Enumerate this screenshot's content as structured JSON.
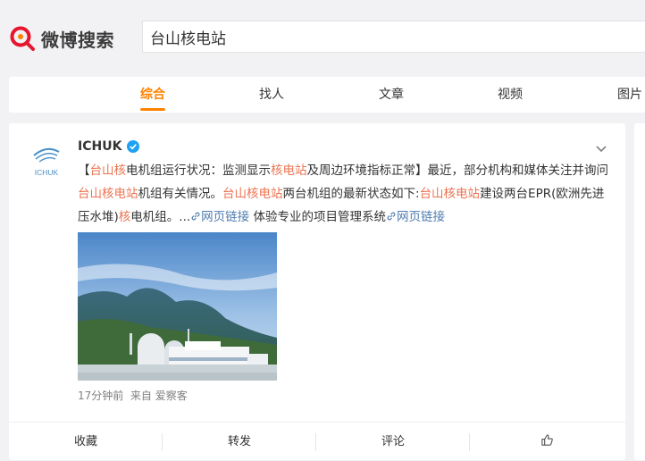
{
  "logo": {
    "text": "微博搜索"
  },
  "search": {
    "value": "台山核电站"
  },
  "tabs": [
    {
      "label": "综合",
      "active": true
    },
    {
      "label": "找人",
      "active": false
    },
    {
      "label": "文章",
      "active": false
    },
    {
      "label": "视频",
      "active": false
    },
    {
      "label": "图片",
      "active": false
    }
  ],
  "post": {
    "avatar_label": "ICHUK",
    "username": "ICHUK",
    "content": {
      "p1": "【",
      "p2": "台山核",
      "p3": "电机组运行状况：监测显示",
      "p4": "核电站",
      "p5": "及周边环境指标正常】最近，部分机构和媒体关注并询问",
      "p6": "台山核电站",
      "p7": "机组有关情况。",
      "p8": "台山核电站",
      "p9": "两台机组的最新状态如下:",
      "p10": "台山核电站",
      "p11": "建设两台EPR(欧洲先进压水堆)",
      "p12": "核",
      "p13": "电机组。...",
      "link1": "网页链接",
      "p14": " 体验专业的项目管理系统",
      "link2": "网页链接"
    },
    "time": "17分钟前",
    "source": "来自 爱察客"
  },
  "actions": {
    "collect": "收藏",
    "repost": "转发",
    "comment": "评论"
  },
  "colors": {
    "accent": "#ff8200",
    "highlight": "#eb7350",
    "link": "#507daf",
    "verified": "#1da1f2"
  }
}
